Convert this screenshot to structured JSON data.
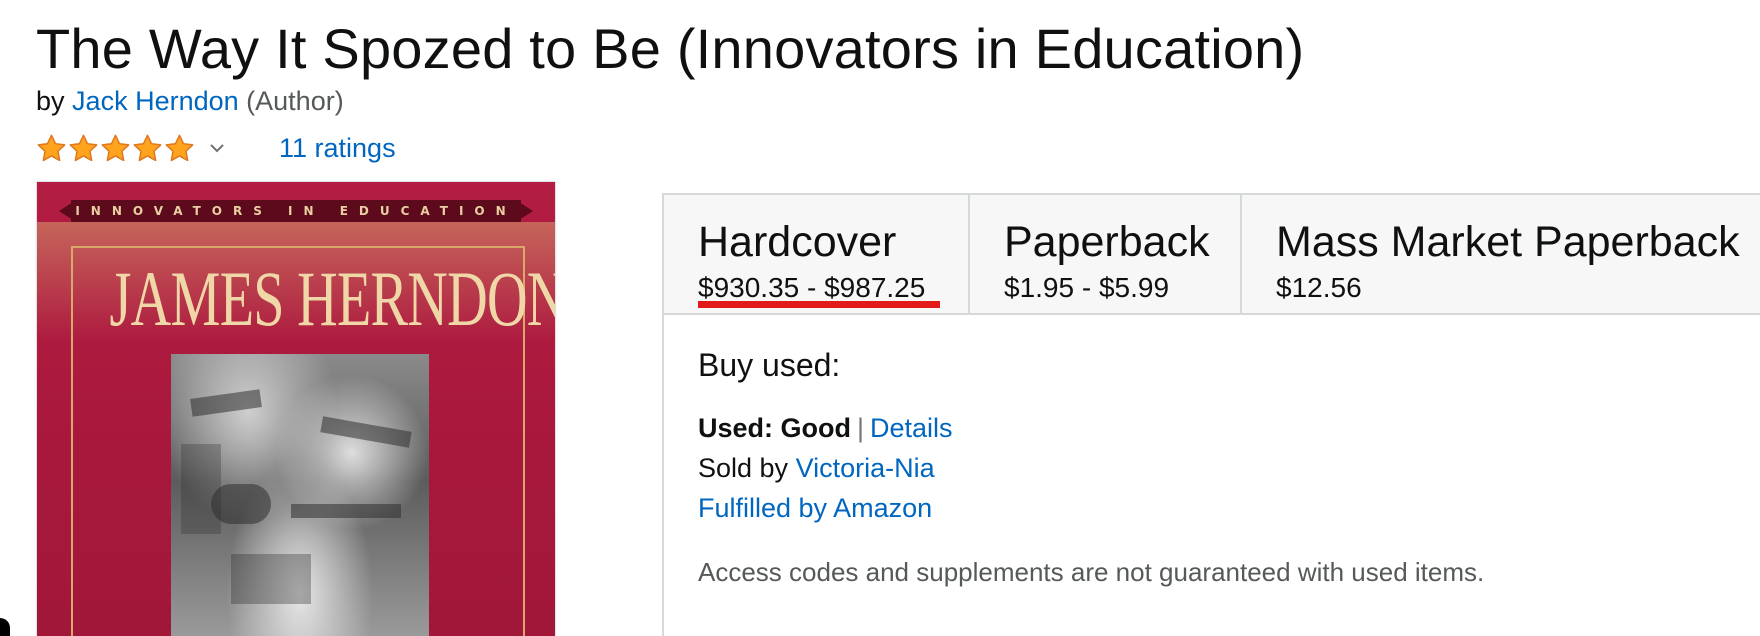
{
  "product": {
    "title": "The Way It Spozed to Be (Innovators in Education)",
    "by_prefix": "by",
    "author_name": "Jack Herndon",
    "author_role": "(Author)",
    "rating_stars": 5,
    "ratings_count_label": "11 ratings"
  },
  "cover": {
    "series_text": "INNOVATORS IN EDUCATION",
    "author_text": "JAMES HERNDON"
  },
  "formats": [
    {
      "name": "Hardcover",
      "price": "$930.35 - $987.25",
      "selected": true
    },
    {
      "name": "Paperback",
      "price": "$1.95 - $5.99",
      "selected": false
    },
    {
      "name": "Mass Market Paperback",
      "price": "$12.56",
      "selected": false
    }
  ],
  "buy_used": {
    "heading": "Buy used:",
    "condition_label": "Used: Good",
    "separator": "|",
    "details_link": "Details",
    "sold_by_prefix": "Sold by",
    "seller_name": "Victoria-Nia",
    "fulfilled_link": "Fulfilled by Amazon",
    "notice": "Access codes and supplements are not guaranteed with used items."
  },
  "colors": {
    "link": "#0066c0",
    "star": "#ffa41c",
    "selected_underline": "#e21a1a",
    "tab_background": "#f7f7f7",
    "cover_background": "#b31d43"
  }
}
